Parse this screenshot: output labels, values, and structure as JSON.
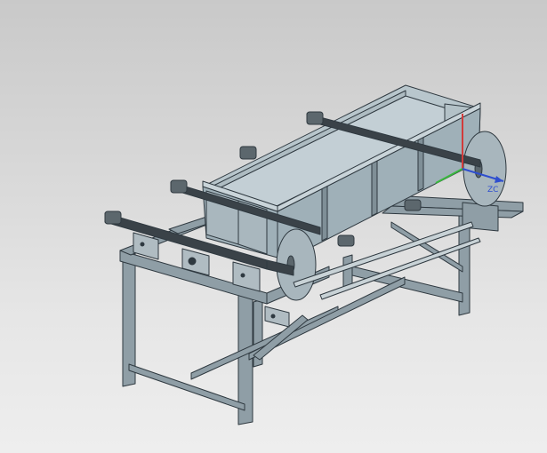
{
  "viewport": {
    "background_top": "#c9c9c9",
    "background_bottom": "#eeeeee"
  },
  "model": {
    "frame_color": "#8f9ea6",
    "frame_edge": "#2f3940",
    "trough_color": "#9fb0b8",
    "trough_inner": "#c3cfd5",
    "wheel_color": "#a8b6bd",
    "chain_color": "#3a4248"
  },
  "triad": {
    "x_color": "#d23b3b",
    "y_color": "#39b83d",
    "z_color": "#2f4fcf",
    "z_label": "ZC"
  }
}
